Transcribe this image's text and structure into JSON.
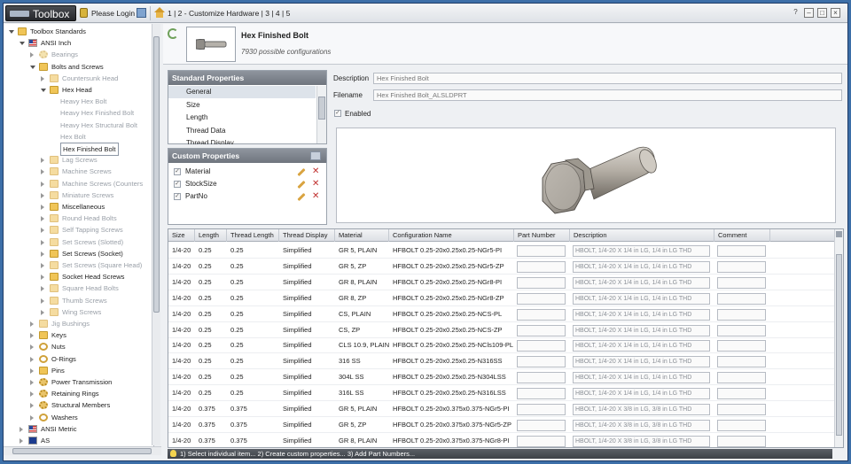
{
  "titlebar": {
    "app_name": "Toolbox",
    "login": "Please Login",
    "breadcrumb": [
      "1",
      "2 - Customize Hardware",
      "3",
      "4",
      "5"
    ],
    "window_buttons": [
      "?",
      "–",
      "□",
      "×"
    ]
  },
  "tree": {
    "items": [
      {
        "label": "Toolbox Standards",
        "level": 0,
        "state": "open",
        "icon": "folder-icon",
        "dim": false
      },
      {
        "label": "ANSI Inch",
        "level": 1,
        "state": "open",
        "icon": "us-flag-icon",
        "dim": false
      },
      {
        "label": "Bearings",
        "level": 2,
        "state": "closed",
        "icon": "gear-icon",
        "dim": true
      },
      {
        "label": "Bolts and Screws",
        "level": 2,
        "state": "open",
        "icon": "folder-icon",
        "dim": false
      },
      {
        "label": "Countersunk Head",
        "level": 3,
        "state": "closed",
        "icon": "folder-icon",
        "dim": true
      },
      {
        "label": "Hex Head",
        "level": 3,
        "state": "open",
        "icon": "folder-icon",
        "dim": false
      },
      {
        "label": "Heavy Hex Bolt",
        "level": 4,
        "state": "none",
        "icon": "",
        "dim": true
      },
      {
        "label": "Heavy Hex Finished Bolt",
        "level": 4,
        "state": "none",
        "icon": "",
        "dim": true
      },
      {
        "label": "Heavy Hex Structural Bolt",
        "level": 4,
        "state": "none",
        "icon": "",
        "dim": true
      },
      {
        "label": "Hex Bolt",
        "level": 4,
        "state": "none",
        "icon": "",
        "dim": true
      },
      {
        "label": "Hex Finished Bolt",
        "level": 4,
        "state": "none",
        "icon": "",
        "dim": false,
        "selected": true
      },
      {
        "label": "Lag Screws",
        "level": 3,
        "state": "closed",
        "icon": "folder-icon",
        "dim": true
      },
      {
        "label": "Machine Screws",
        "level": 3,
        "state": "closed",
        "icon": "folder-icon",
        "dim": true
      },
      {
        "label": "Machine Screws (Counters",
        "level": 3,
        "state": "closed",
        "icon": "folder-icon",
        "dim": true
      },
      {
        "label": "Miniature Screws",
        "level": 3,
        "state": "closed",
        "icon": "folder-icon",
        "dim": true
      },
      {
        "label": "Miscellaneous",
        "level": 3,
        "state": "closed",
        "icon": "folder-icon",
        "dim": false
      },
      {
        "label": "Round Head Bolts",
        "level": 3,
        "state": "closed",
        "icon": "folder-icon",
        "dim": true
      },
      {
        "label": "Self Tapping Screws",
        "level": 3,
        "state": "closed",
        "icon": "folder-icon",
        "dim": true
      },
      {
        "label": "Set Screws (Slotted)",
        "level": 3,
        "state": "closed",
        "icon": "folder-icon",
        "dim": true
      },
      {
        "label": "Set Screws (Socket)",
        "level": 3,
        "state": "closed",
        "icon": "folder-icon",
        "dim": false
      },
      {
        "label": "Set Screws (Square Head)",
        "level": 3,
        "state": "closed",
        "icon": "folder-icon",
        "dim": true
      },
      {
        "label": "Socket Head Screws",
        "level": 3,
        "state": "closed",
        "icon": "folder-icon",
        "dim": false
      },
      {
        "label": "Square Head Bolts",
        "level": 3,
        "state": "closed",
        "icon": "folder-icon",
        "dim": true
      },
      {
        "label": "Thumb Screws",
        "level": 3,
        "state": "closed",
        "icon": "folder-icon",
        "dim": true
      },
      {
        "label": "Wing Screws",
        "level": 3,
        "state": "closed",
        "icon": "folder-icon",
        "dim": true
      },
      {
        "label": "Jig Bushings",
        "level": 2,
        "state": "closed",
        "icon": "folder-icon",
        "dim": true
      },
      {
        "label": "Keys",
        "level": 2,
        "state": "closed",
        "icon": "folder-icon",
        "dim": false
      },
      {
        "label": "Nuts",
        "level": 2,
        "state": "closed",
        "icon": "ring-icon",
        "dim": false
      },
      {
        "label": "O-Rings",
        "level": 2,
        "state": "closed",
        "icon": "ring-icon",
        "dim": false
      },
      {
        "label": "Pins",
        "level": 2,
        "state": "closed",
        "icon": "folder-icon",
        "dim": false
      },
      {
        "label": "Power Transmission",
        "level": 2,
        "state": "closed",
        "icon": "gear-icon",
        "dim": false
      },
      {
        "label": "Retaining Rings",
        "level": 2,
        "state": "closed",
        "icon": "gear-icon",
        "dim": false
      },
      {
        "label": "Structural Members",
        "level": 2,
        "state": "closed",
        "icon": "gear-icon",
        "dim": false
      },
      {
        "label": "Washers",
        "level": 2,
        "state": "closed",
        "icon": "ring-icon",
        "dim": false
      },
      {
        "label": "ANSI Metric",
        "level": 1,
        "state": "closed",
        "icon": "us-flag-icon",
        "dim": false
      },
      {
        "label": "AS",
        "level": 1,
        "state": "closed",
        "icon": "au-flag-icon",
        "dim": false
      }
    ]
  },
  "header": {
    "title": "Hex Finished Bolt",
    "subtitle": "7930 possible configurations"
  },
  "standard_properties": {
    "title": "Standard Properties",
    "items": [
      "General",
      "Size",
      "Length",
      "Thread Data",
      "Thread Display"
    ]
  },
  "custom_properties": {
    "title": "Custom Properties",
    "items": [
      "Material",
      "StockSize",
      "PartNo"
    ]
  },
  "form": {
    "description_label": "Description",
    "description_value": "Hex Finished Bolt",
    "filename_label": "Filename",
    "filename_value": "Hex Finished Bolt_ALSLDPRT",
    "enabled_label": "Enabled"
  },
  "grid": {
    "columns": [
      "Size",
      "Length",
      "Thread Length",
      "Thread Display",
      "Material",
      "Configuration Name",
      "Part Number",
      "Description",
      "Comment"
    ],
    "rows": [
      [
        "1/4-20",
        "0.25",
        "0.25",
        "Simplified",
        "GR 5, PLAIN",
        "HFBOLT 0.25-20x0.25x0.25-NGr5-PI",
        "",
        "HBOLT, 1/4-20 X 1/4 in LG, 1/4 in LG THD",
        ""
      ],
      [
        "1/4-20",
        "0.25",
        "0.25",
        "Simplified",
        "GR 5, ZP",
        "HFBOLT 0.25-20x0.25x0.25-NGr5-ZP",
        "",
        "HBOLT, 1/4-20 X 1/4 in LG, 1/4 in LG THD",
        ""
      ],
      [
        "1/4-20",
        "0.25",
        "0.25",
        "Simplified",
        "GR 8, PLAIN",
        "HFBOLT 0.25-20x0.25x0.25-NGr8-PI",
        "",
        "HBOLT, 1/4-20 X 1/4 in LG, 1/4 in LG THD",
        ""
      ],
      [
        "1/4-20",
        "0.25",
        "0.25",
        "Simplified",
        "GR 8, ZP",
        "HFBOLT 0.25-20x0.25x0.25-NGr8-ZP",
        "",
        "HBOLT, 1/4-20 X 1/4 in LG, 1/4 in LG THD",
        ""
      ],
      [
        "1/4-20",
        "0.25",
        "0.25",
        "Simplified",
        "CS, PLAIN",
        "HFBOLT 0.25-20x0.25x0.25-NCS-PL",
        "",
        "HBOLT, 1/4-20 X 1/4 in LG, 1/4 in LG THD",
        ""
      ],
      [
        "1/4-20",
        "0.25",
        "0.25",
        "Simplified",
        "CS, ZP",
        "HFBOLT 0.25-20x0.25x0.25-NCS-ZP",
        "",
        "HBOLT, 1/4-20 X 1/4 in LG, 1/4 in LG THD",
        ""
      ],
      [
        "1/4-20",
        "0.25",
        "0.25",
        "Simplified",
        "CLS 10.9, PLAIN",
        "HFBOLT 0.25-20x0.25x0.25-NCls109-PL",
        "",
        "HBOLT, 1/4-20 X 1/4 in LG, 1/4 in LG THD",
        ""
      ],
      [
        "1/4-20",
        "0.25",
        "0.25",
        "Simplified",
        "316 SS",
        "HFBOLT 0.25-20x0.25x0.25-N316SS",
        "",
        "HBOLT, 1/4-20 X 1/4 in LG, 1/4 in LG THD",
        ""
      ],
      [
        "1/4-20",
        "0.25",
        "0.25",
        "Simplified",
        "304L SS",
        "HFBOLT 0.25-20x0.25x0.25-N304LSS",
        "",
        "HBOLT, 1/4-20 X 1/4 in LG, 1/4 in LG THD",
        ""
      ],
      [
        "1/4-20",
        "0.25",
        "0.25",
        "Simplified",
        "316L SS",
        "HFBOLT 0.25-20x0.25x0.25-N316LSS",
        "",
        "HBOLT, 1/4-20 X 1/4 in LG, 1/4 in LG THD",
        ""
      ],
      [
        "1/4-20",
        "0.375",
        "0.375",
        "Simplified",
        "GR 5, PLAIN",
        "HFBOLT 0.25-20x0.375x0.375-NGr5-PI",
        "",
        "HBOLT, 1/4-20 X 3/8 in LG, 3/8 in LG THD",
        ""
      ],
      [
        "1/4-20",
        "0.375",
        "0.375",
        "Simplified",
        "GR 5, ZP",
        "HFBOLT 0.25-20x0.375x0.375-NGr5-ZP",
        "",
        "HBOLT, 1/4-20 X 3/8 in LG, 3/8 in LG THD",
        ""
      ],
      [
        "1/4-20",
        "0.375",
        "0.375",
        "Simplified",
        "GR 8, PLAIN",
        "HFBOLT 0.25-20x0.375x0.375-NGr8-PI",
        "",
        "HBOLT, 1/4-20 X 3/8 in LG, 3/8 in LG THD",
        ""
      ]
    ]
  },
  "status": {
    "text": "1) Select individual item... 2) Create custom properties... 3) Add Part Numbers..."
  }
}
